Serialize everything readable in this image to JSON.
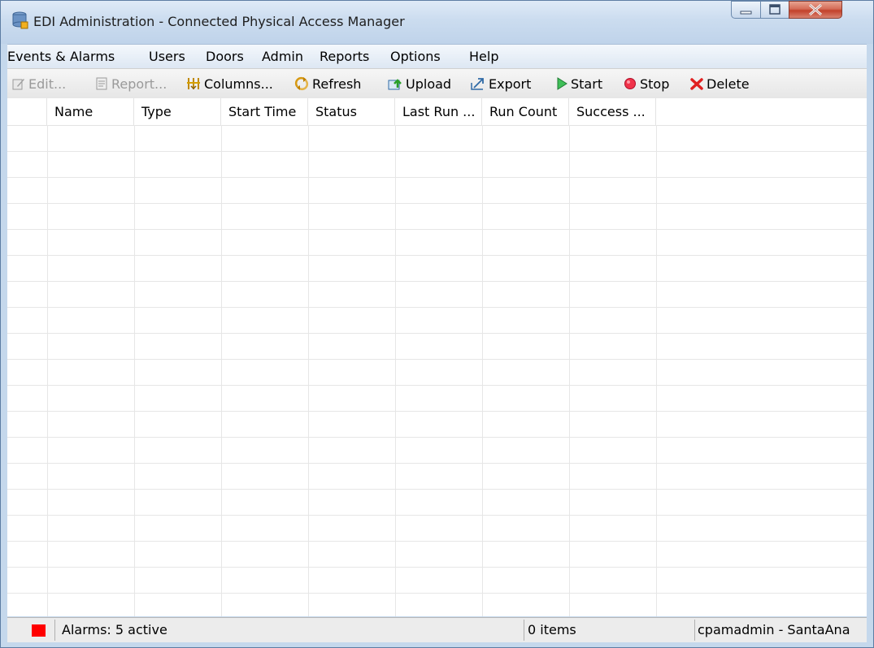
{
  "window": {
    "title": "EDI Administration - Connected Physical Access Manager"
  },
  "menu": [
    {
      "label": "Events & Alarms"
    },
    {
      "label": "Users"
    },
    {
      "label": "Doors"
    },
    {
      "label": "Admin"
    },
    {
      "label": "Reports"
    },
    {
      "label": "Options"
    },
    {
      "label": "Help"
    }
  ],
  "toolbar": {
    "edit": {
      "label": "Edit...",
      "icon": "edit-icon",
      "enabled": false
    },
    "report": {
      "label": "Report...",
      "icon": "report-icon",
      "enabled": false
    },
    "columns": {
      "label": "Columns...",
      "icon": "columns-icon",
      "enabled": true
    },
    "refresh": {
      "label": "Refresh",
      "icon": "refresh-icon",
      "enabled": true
    },
    "upload": {
      "label": "Upload",
      "icon": "upload-icon",
      "enabled": true
    },
    "export": {
      "label": "Export",
      "icon": "export-icon",
      "enabled": true
    },
    "start": {
      "label": "Start",
      "icon": "play-icon",
      "enabled": true
    },
    "stop": {
      "label": "Stop",
      "icon": "stop-icon",
      "enabled": true
    },
    "delete": {
      "label": "Delete",
      "icon": "delete-icon",
      "enabled": true
    }
  },
  "table": {
    "columns": [
      {
        "label": "Name"
      },
      {
        "label": "Type"
      },
      {
        "label": "Start Time"
      },
      {
        "label": "Status"
      },
      {
        "label": "Last Run ..."
      },
      {
        "label": "Run Count"
      },
      {
        "label": "Success ..."
      }
    ],
    "rows": []
  },
  "status": {
    "alarms": "Alarms: 5 active",
    "items": "0 items",
    "user": "cpamadmin - SantaAna",
    "alarm_color": "#ff0000"
  }
}
